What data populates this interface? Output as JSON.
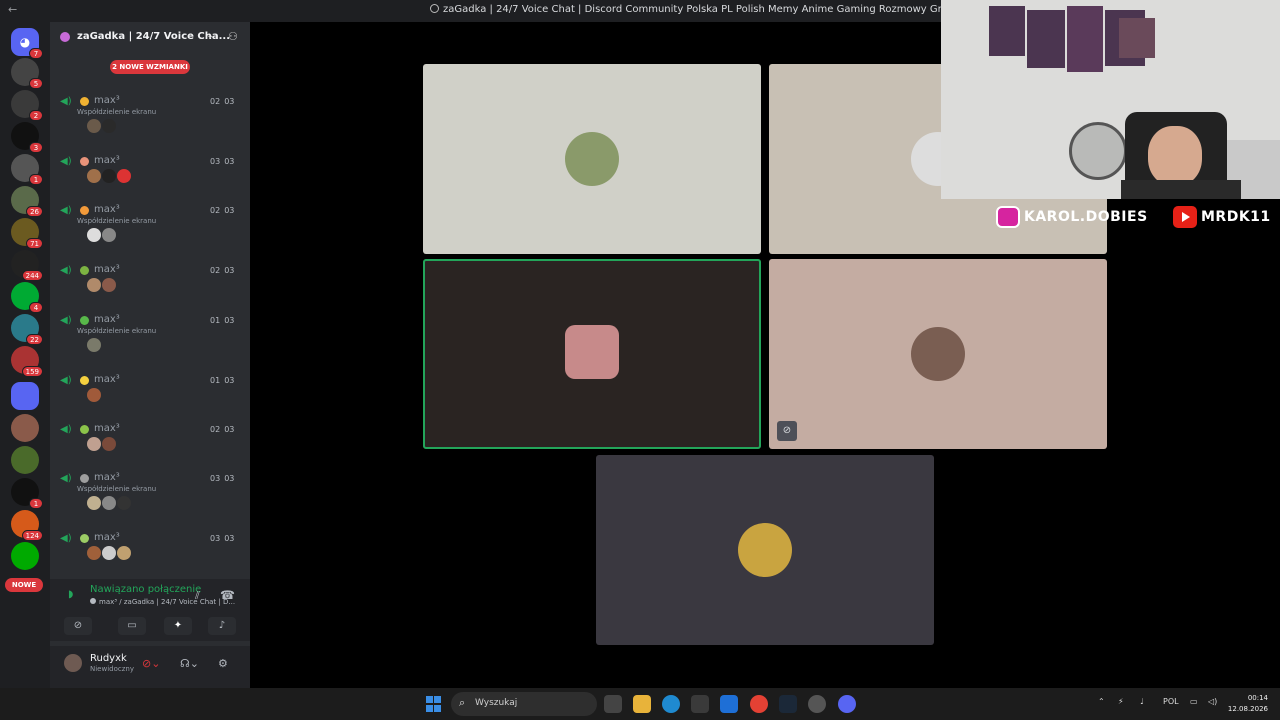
{
  "window": {
    "title": "zaGadka | 24/7 Voice Chat | Discord Community Polska PL Polish Memy Anime Gaming Rozmowy Gry",
    "back_icon": "arrow-left-icon"
  },
  "servers": {
    "badges": [
      "7",
      "5",
      "2",
      "3",
      "1",
      "26",
      "71",
      "244",
      "4",
      "22",
      "159",
      "1",
      "124"
    ],
    "nowe_label": "NOWE"
  },
  "guild": {
    "name": "zaGadka | 24/7 Voice Cha...",
    "mentions_label": "2 NOWE WZMIANKI"
  },
  "voice_channels": [
    {
      "name": "max³",
      "sub": "Współdzielenie ekranu",
      "t1": "02",
      "t2": "03",
      "emoji_color": "#f0b232"
    },
    {
      "name": "max³",
      "sub": "",
      "t1": "03",
      "t2": "03",
      "emoji_color": "#e8937a"
    },
    {
      "name": "max³",
      "sub": "Współdzielenie ekranu",
      "t1": "02",
      "t2": "03",
      "emoji_color": "#f29a3a"
    },
    {
      "name": "max³",
      "sub": "",
      "t1": "02",
      "t2": "03",
      "emoji_color": "#7cb342"
    },
    {
      "name": "max³",
      "sub": "Współdzielenie ekranu",
      "t1": "01",
      "t2": "03",
      "emoji_color": "#58b84a"
    },
    {
      "name": "max³",
      "sub": "",
      "t1": "01",
      "t2": "03",
      "emoji_color": "#f4d03f"
    },
    {
      "name": "max³",
      "sub": "",
      "t1": "02",
      "t2": "03",
      "emoji_color": "#8bc34a"
    },
    {
      "name": "max³",
      "sub": "Współdzielenie ekranu",
      "t1": "03",
      "t2": "03",
      "emoji_color": "#9e9e9e"
    },
    {
      "name": "max³",
      "sub": "",
      "t1": "03",
      "t2": "03",
      "emoji_color": "#9ccc65"
    }
  ],
  "voice_panel": {
    "status": "Nawiązano połączenie",
    "location": "max³ / zaGadka | 24/7 Voice Chat | D..."
  },
  "user": {
    "name": "Rudyxk",
    "status": "Niewidoczny"
  },
  "overlay": {
    "instagram": "KAROL.DOBIES",
    "youtube": "MRDK11"
  },
  "taskbar": {
    "search_placeholder": "Wyszukaj",
    "language": "POL",
    "time": "00:14",
    "date": "12.08.2026"
  }
}
